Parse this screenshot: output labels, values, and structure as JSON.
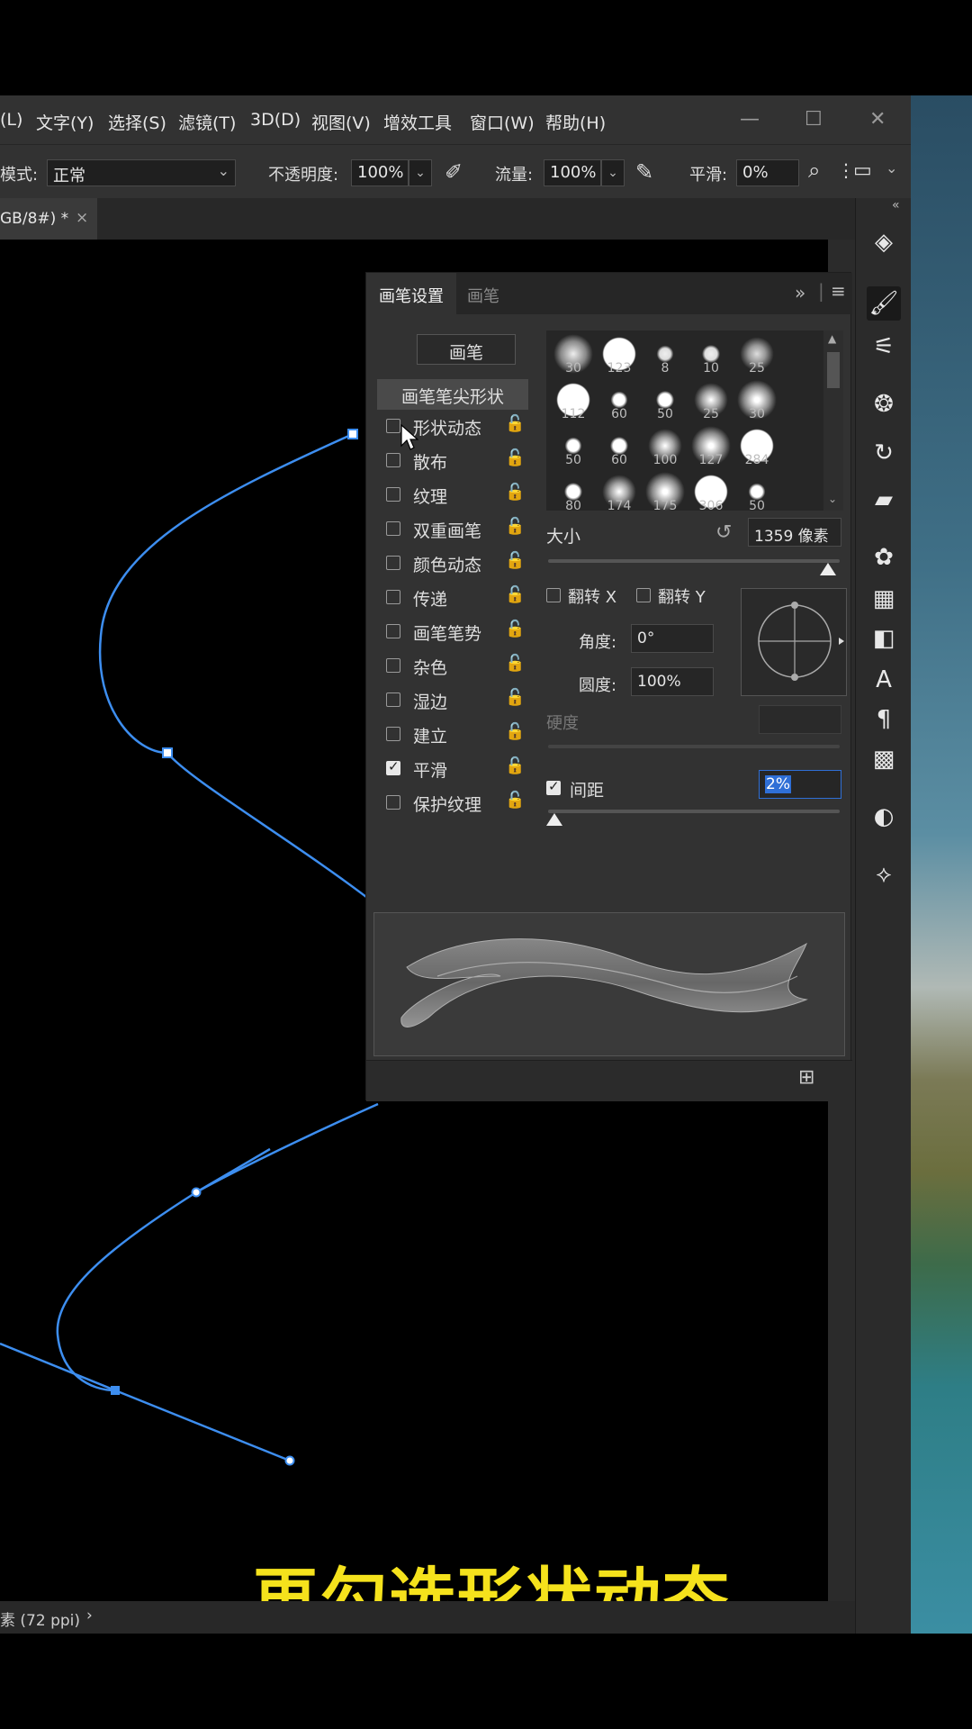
{
  "menubar": {
    "items": [
      "(L)",
      "文字(Y)",
      "选择(S)",
      "滤镜(T)",
      "3D(D)",
      "视图(V)",
      "增效工具",
      "窗口(W)",
      "帮助(H)"
    ]
  },
  "options_bar": {
    "mode_label": "模式:",
    "mode_value": "正常",
    "opacity_label": "不透明度:",
    "opacity_value": "100%",
    "flow_label": "流量:",
    "flow_value": "100%",
    "smoothing_label": "平滑:",
    "smoothing_value": "0%"
  },
  "document": {
    "tab_title": "GB/8#) *",
    "close_glyph": "×",
    "status_text": "素 (72 ppi)",
    "status_arrow": "›"
  },
  "brush_panel": {
    "tab_active": "画笔设置",
    "tab_inactive": "画笔",
    "brushes_button": "画笔",
    "tip_shape_header": "画笔笔尖形状",
    "options": [
      {
        "label": "形状动态",
        "checked": false
      },
      {
        "label": "散布",
        "checked": false
      },
      {
        "label": "纹理",
        "checked": false
      },
      {
        "label": "双重画笔",
        "checked": false
      },
      {
        "label": "颜色动态",
        "checked": false
      },
      {
        "label": "传递",
        "checked": false
      },
      {
        "label": "画笔笔势",
        "checked": false
      },
      {
        "label": "杂色",
        "checked": false
      },
      {
        "label": "湿边",
        "checked": false
      },
      {
        "label": "建立",
        "checked": false
      },
      {
        "label": "平滑",
        "checked": true
      },
      {
        "label": "保护纹理",
        "checked": false
      }
    ],
    "brush_sizes": [
      "30",
      "123",
      "8",
      "10",
      "25",
      "112",
      "60",
      "50",
      "25",
      "30",
      "50",
      "60",
      "100",
      "127",
      "284",
      "80",
      "174",
      "175",
      "306",
      "50"
    ],
    "size_label": "大小",
    "size_value": "1359 像素",
    "flip_x_label": "翻转 X",
    "flip_y_label": "翻转 Y",
    "angle_label": "角度:",
    "angle_value": "0°",
    "roundness_label": "圆度:",
    "roundness_value": "100%",
    "hardness_label": "硬度",
    "spacing_label": "间距",
    "spacing_checked": true,
    "spacing_value": "2%",
    "size_slider_fraction": 0.96,
    "spacing_slider_fraction": 0.0
  },
  "caption": "再勾选形状动态",
  "colors": {
    "path_blue": "#3d8ef0",
    "caption_yellow": "#f5e21c",
    "accent_blue": "#2f6fd6"
  }
}
